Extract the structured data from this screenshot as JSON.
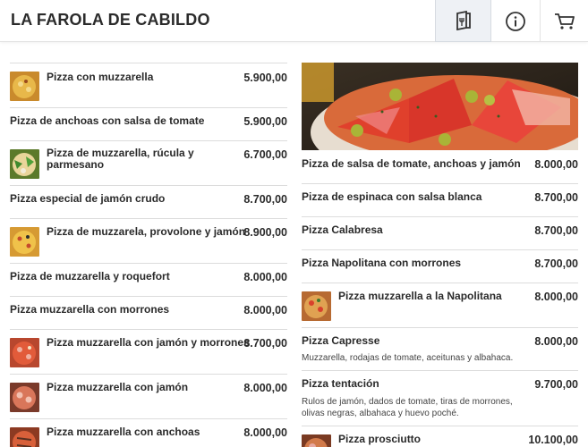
{
  "header": {
    "brand": "LA FAROLA DE CABILDO",
    "menu_icon": "menu-book-icon",
    "info_icon": "info-icon",
    "cart_icon": "cart-icon"
  },
  "left_items": [
    {
      "name": "Pizza con muzzarella",
      "price": "5.900,00",
      "thumb": "pizza-thumbnail"
    },
    {
      "name": "Pizza de anchoas con salsa de tomate",
      "price": "5.900,00"
    },
    {
      "name": "Pizza de muzzarella, rúcula y parmesano",
      "price": "6.700,00",
      "thumb": "pizza-thumbnail"
    },
    {
      "name": "Pizza especial de jamón crudo",
      "price": "8.700,00"
    },
    {
      "name": "Pizza de muzzarela, provolone y jamón",
      "price": "8.900,00",
      "thumb": "pizza-thumbnail"
    },
    {
      "name": "Pizza de muzzarella y roquefort",
      "price": "8.000,00"
    },
    {
      "name": "Pizza muzzarella con morrones",
      "price": "8.000,00"
    },
    {
      "name": "Pizza muzzarella con jamón y morrones",
      "price": "8.700,00",
      "thumb": "pizza-thumbnail"
    },
    {
      "name": "Pizza muzzarella con jamón",
      "price": "8.000,00",
      "thumb": "pizza-thumbnail"
    },
    {
      "name": "Pizza muzzarella con anchoas",
      "price": "8.000,00",
      "thumb": "pizza-thumbnail"
    }
  ],
  "right_items": [
    {
      "name": "Pizza de salsa de tomate, anchoas y jamón",
      "price": "8.000,00"
    },
    {
      "name": "Pizza de espinaca con salsa blanca",
      "price": "8.700,00"
    },
    {
      "name": "Pizza Calabresa",
      "price": "8.700,00"
    },
    {
      "name": "Pizza Napolitana con morrones",
      "price": "8.700,00"
    },
    {
      "name": "Pizza muzzarella a la Napolitana",
      "price": "8.000,00",
      "thumb": "pizza-thumbnail"
    },
    {
      "name": "Pizza Capresse",
      "price": "8.000,00",
      "desc": "Muzzarella, rodajas de tomate, aceitunas y albahaca."
    },
    {
      "name": "Pizza tentación",
      "price": "9.700,00",
      "desc": "Rulos de jamón, dados de tomate, tiras de morrones, olivas negras, albahaca y huevo poché."
    },
    {
      "name": "Pizza prosciutto",
      "price": "10.100,00",
      "thumb": "pizza-thumbnail"
    }
  ],
  "hero": {
    "image": "pizza-with-peppers-and-olives-photo"
  },
  "colors": {
    "header_bg": "#ffffff",
    "active_tab_bg": "#eef1f5",
    "divider": "#dcdcdc",
    "text": "#2a2a2a"
  }
}
